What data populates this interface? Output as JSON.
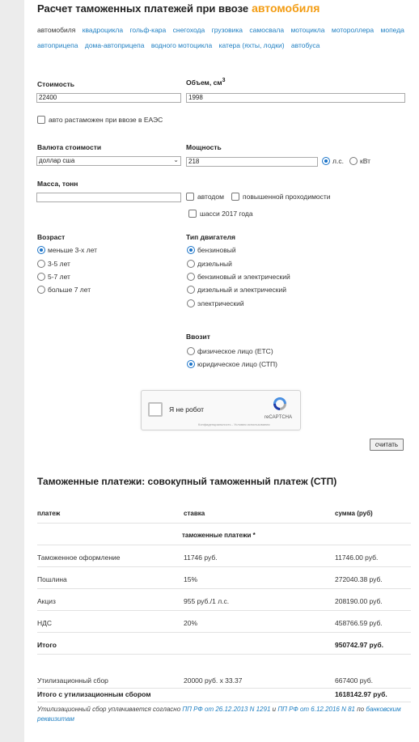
{
  "header": {
    "title": "Расчет таможенных платежей при ввозе",
    "title_accent": "автомобиля"
  },
  "vehicle_types": [
    "автомобиля",
    "квадроцикла",
    "гольф-кара",
    "снегохода",
    "грузовика",
    "самосвала",
    "мотоцикла",
    "мотороллера",
    "мопеда",
    "автоприцепа",
    "дома-автоприцепа",
    "водного мотоцикла",
    "катера (яхты, лодки)",
    "автобуса"
  ],
  "form": {
    "cost_label": "Стоимость",
    "cost_value": "22400",
    "volume_label": "Объем, см",
    "volume_sup": "3",
    "volume_value": "1998",
    "eaes_label": "авто растаможен при ввозе в ЕАЭС",
    "currency_label": "Валюта стоимости",
    "currency_value": "доллар сша",
    "power_label": "Мощность",
    "power_value": "218",
    "power_unit_hp": "л.с.",
    "power_unit_kw": "кВт",
    "mass_label": "Масса, тонн",
    "mass_value": "",
    "autohome_label": "автодом",
    "offroad_label": "повышенной проходимости",
    "chassis_label": "шасси 2017 года",
    "age_label": "Возраст",
    "age_options": [
      "меньше 3-х лет",
      "3-5 лет",
      "5-7 лет",
      "больше 7 лет"
    ],
    "engine_label": "Тип двигателя",
    "engine_options": [
      "бензиновый",
      "дизельный",
      "бензиновый и электрический",
      "дизельный и электрический",
      "электрический"
    ],
    "importer_label": "Ввозит",
    "importer_options": [
      "физическое лицо (ЕТС)",
      "юридическое лицо (СТП)"
    ],
    "submit_label": "считать"
  },
  "captcha": {
    "label": "Я не робот",
    "brand": "reCAPTCHA",
    "terms": "Конфиденциальность - Условия использования"
  },
  "results": {
    "title": "Таможенные платежи: совокупный таможенный платеж (СТП)",
    "headers": [
      "платеж",
      "ставка",
      "сумма (руб)"
    ],
    "subheader": "таможенные платежи *",
    "rows": [
      [
        "Таможенное оформление",
        "11746 руб.",
        "11746.00 руб."
      ],
      [
        "Пошлина",
        "15%",
        "272040.38 руб."
      ],
      [
        "Акциз",
        "955 руб./1 л.с.",
        "208190.00 руб."
      ],
      [
        "НДС",
        "20%",
        "458766.59 руб."
      ]
    ],
    "total_label": "Итого",
    "total_value": "950742.97 руб.",
    "util_label": "Утилизационный сбор",
    "util_rate": "20000 руб. x 33.37",
    "util_value": "667400 руб.",
    "grand_label": "Итого с утилизационным сбором",
    "grand_value": "1618142.97 руб.",
    "note_prefix": "Утилизационный сбор уплачивается согласно ",
    "note_link1": "ПП РФ от 26.12.2013 N 1291",
    "note_and": " и ",
    "note_link2": "ПП РФ от 6.12.2016 N 81",
    "note_mid": " по ",
    "note_link3": "банковским реквизитам"
  },
  "colors": {
    "accent": "#f39c12",
    "link": "#1f7fc2",
    "radio_selected": "#1a73c8"
  }
}
